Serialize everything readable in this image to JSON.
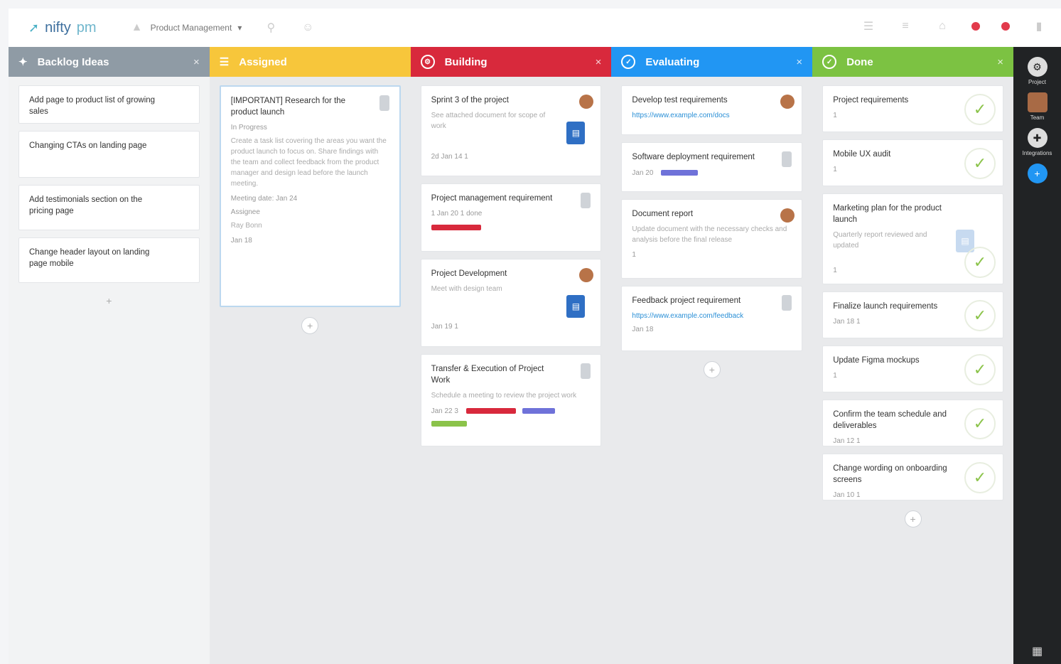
{
  "app": {
    "logo_text": "nifty",
    "logo_text_2": "pm"
  },
  "topbar": {
    "workspace_name": "Product Management",
    "workspace_caret": "▾"
  },
  "colors": {
    "col1": "#8f9ba5",
    "col2": "#f7c63b",
    "col3": "#d8293c",
    "col4": "#2196f3",
    "col5": "#7cc242",
    "green_tag": "#8bc34a",
    "red_tag": "#d8293c",
    "purple_tag": "#6f72d9"
  },
  "columns": [
    {
      "title": "Backlog Ideas",
      "cards": [
        {
          "title": "Add page to product list of growing sales"
        },
        {
          "title": "Changing CTAs on landing page"
        },
        {
          "title": "Add testimonials section on the pricing page"
        },
        {
          "title": "Change header layout on landing page mobile"
        }
      ]
    },
    {
      "title": "Assigned",
      "cards": [
        {
          "title": "[IMPORTANT] Research for the product launch",
          "meta": "In Progress",
          "desc": "Create a task list covering the areas you want the product launch to focus on. Share findings with the team and collect feedback from the product manager and design lead before the launch meeting.",
          "extra": "Meeting date: Jan 24",
          "label": "Assignee",
          "owner": "Ray Bonn",
          "foot": "Jan 18"
        }
      ]
    },
    {
      "title": "Building",
      "cards": [
        {
          "title": "Sprint 3 of the project",
          "desc": "See attached document for scope of work",
          "foot": "2d   Jan 14   1"
        },
        {
          "title": "Project management requirement",
          "foot": "1    Jan 20   1 done"
        },
        {
          "title": "Project Development",
          "desc": "Meet with design team",
          "foot": "Jan 19   1"
        },
        {
          "title": "Transfer & Execution of Project Work",
          "desc": "Schedule a meeting to review the project work",
          "foot": "Jan 22   3"
        }
      ]
    },
    {
      "title": "Evaluating",
      "cards": [
        {
          "title": "Develop test requirements",
          "link": "https://www.example.com/docs"
        },
        {
          "title": "Software deployment requirement",
          "foot": "Jan 20"
        },
        {
          "title": "Document report",
          "desc": "Update document with the necessary checks and analysis before the final release",
          "foot": "1"
        },
        {
          "title": "Feedback project requirement",
          "link": "https://www.example.com/feedback",
          "foot": "Jan 18"
        }
      ]
    },
    {
      "title": "Done",
      "cards": [
        {
          "title": "Project requirements",
          "foot": "1"
        },
        {
          "title": "Mobile UX audit",
          "foot": "1"
        },
        {
          "title": "Marketing plan for the product launch",
          "desc": "Quarterly report reviewed and updated",
          "foot": "1"
        },
        {
          "title": "Finalize launch requirements",
          "foot": "Jan 18   1"
        },
        {
          "title": "Update Figma mockups",
          "foot": "1"
        },
        {
          "title": "Confirm the team schedule and deliverables",
          "foot": "Jan 12   1"
        },
        {
          "title": "Change wording on onboarding screens",
          "foot": "Jan 10   1"
        }
      ]
    }
  ],
  "rail": {
    "items": [
      {
        "label": "Project",
        "icon": "gear-icon"
      },
      {
        "label": "Team",
        "icon": "user-photo"
      },
      {
        "label": "Integrations",
        "icon": "puzzle-icon"
      },
      {
        "label": "",
        "icon": "plus-icon"
      }
    ]
  }
}
